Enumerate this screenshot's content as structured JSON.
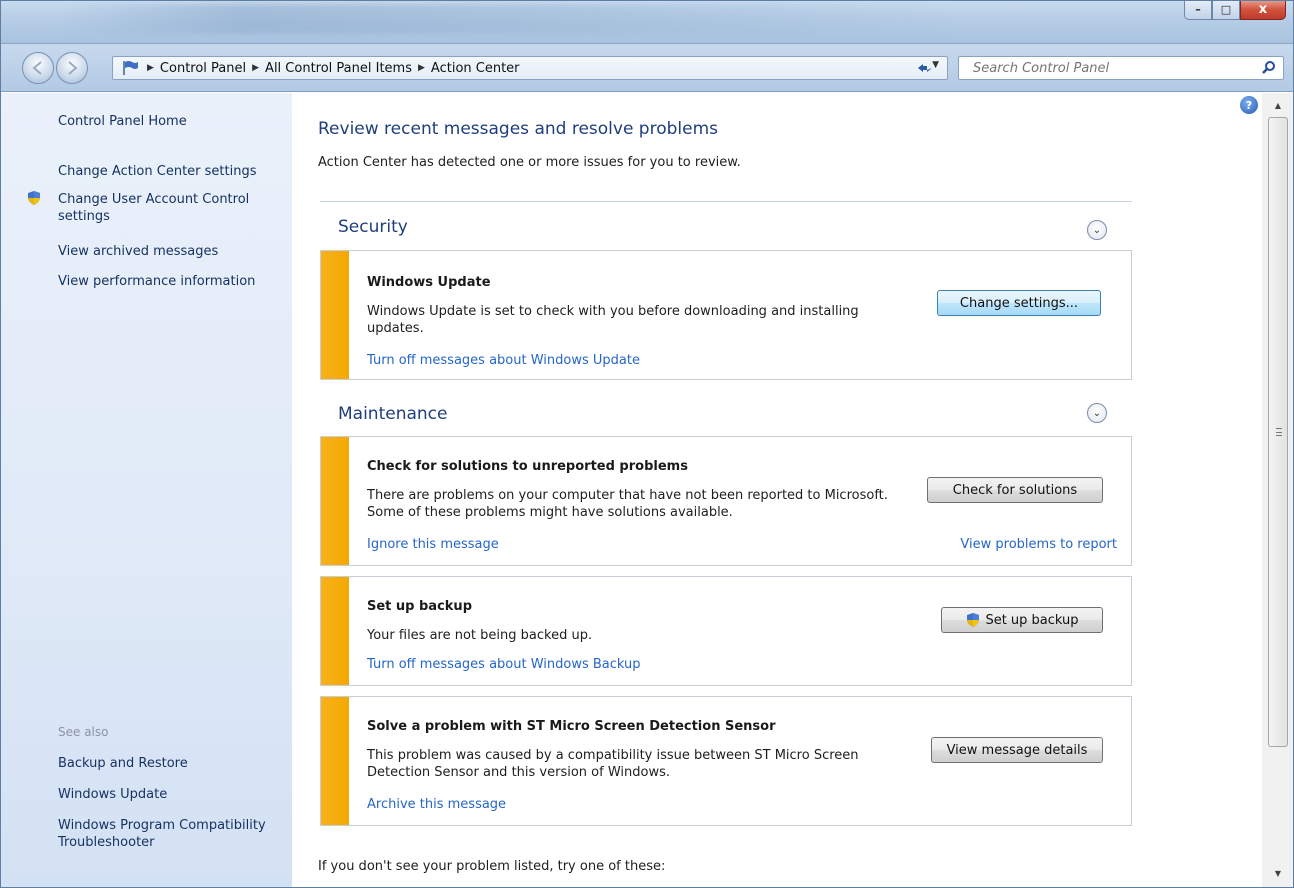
{
  "window": {
    "controls": {
      "minimize": "–",
      "maximize": "□",
      "close": "x"
    }
  },
  "navbar": {
    "breadcrumbs": [
      "Control Panel",
      "All Control Panel Items",
      "Action Center"
    ],
    "search_placeholder": "Search Control Panel",
    "icons": {
      "back": "back-arrow-icon",
      "forward": "forward-arrow-icon",
      "flag": "action-center-flag-icon",
      "refresh": "refresh-icon",
      "search": "magnifier-icon"
    }
  },
  "sidebar": {
    "home": "Control Panel Home",
    "links": [
      "Change Action Center settings",
      "Change User Account Control settings",
      "View archived messages",
      "View performance information"
    ],
    "see_also_label": "See also",
    "see_also": [
      "Backup and Restore",
      "Windows Update",
      "Windows Program Compatibility Troubleshooter"
    ]
  },
  "main": {
    "title": "Review recent messages and resolve problems",
    "subtitle": "Action Center has detected one or more issues for you to review.",
    "sections": [
      {
        "heading": "Security",
        "cards": [
          {
            "title": "Windows Update",
            "body": "Windows Update is set to check with you before downloading and installing updates.",
            "link": "Turn off messages about Windows Update",
            "button": "Change settings..."
          }
        ]
      },
      {
        "heading": "Maintenance",
        "cards": [
          {
            "title": "Check for solutions to unreported problems",
            "body": "There are problems on your computer that have not been reported to Microsoft. Some of these problems might have solutions available.",
            "link": "Ignore this message",
            "right_link": "View problems to report",
            "button": "Check for solutions"
          },
          {
            "title": "Set up backup",
            "body": "Your files are not being backed up.",
            "link": "Turn off messages about Windows Backup",
            "button": "Set up backup"
          },
          {
            "title": "Solve a problem with ST Micro Screen Detection Sensor",
            "body": "This problem was caused by a compatibility issue between ST Micro Screen Detection Sensor and this version of Windows.",
            "link": "Archive this message",
            "button": "View message details"
          }
        ]
      }
    ],
    "footer": "If you don't see your problem listed, try one of these:"
  },
  "colors": {
    "accent_bar": "#f5ad10",
    "heading": "#1e3e7d",
    "link": "#2566c8",
    "sidebar_bg": "#e3ecf8"
  }
}
